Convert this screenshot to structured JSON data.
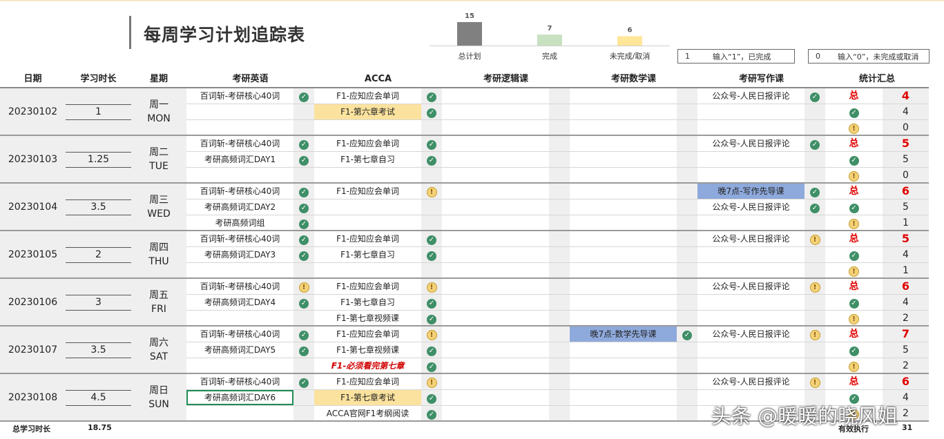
{
  "title": "每周学习计划追踪表",
  "summary_chart": {
    "bars": [
      {
        "label": "总计划",
        "value": 15,
        "color": "#808080"
      },
      {
        "label": "完成",
        "value": 7,
        "color": "#c8e1c0"
      },
      {
        "label": "未完成/取消",
        "value": 6,
        "color": "#ffe699"
      }
    ]
  },
  "legend": [
    {
      "num": "1",
      "text": "输入“1”，已完成"
    },
    {
      "num": "0",
      "text": "输入“0”，未完成或取消"
    }
  ],
  "headers": [
    "日期",
    "学习时长",
    "星期",
    "考研英语",
    "ACCA",
    "考研逻辑课",
    "考研数学课",
    "考研写作课",
    "统计汇总"
  ],
  "days": [
    {
      "date": "20230102",
      "hours": "1",
      "weekday_cn": "周一",
      "weekday_en": "MON",
      "english": [
        [
          "百词斩-考研核心40词",
          "ok"
        ],
        [
          "",
          ""
        ],
        [
          "",
          ""
        ]
      ],
      "acca": [
        [
          "F1-应知应会单词",
          "ok"
        ],
        [
          "F1-第六章考试",
          "ok",
          "#fbe29e"
        ],
        [
          "",
          ""
        ]
      ],
      "logic": [
        [
          "",
          ""
        ],
        [
          "",
          ""
        ],
        [
          "",
          ""
        ]
      ],
      "math": [
        [
          "",
          ""
        ],
        [
          "",
          ""
        ],
        [
          "",
          ""
        ]
      ],
      "writing": [
        [
          "公众号-人民日报评论",
          "ok"
        ],
        [
          "",
          ""
        ],
        [
          "",
          ""
        ]
      ],
      "stats": {
        "total_label": "总",
        "total": "4",
        "done": "4",
        "undone": "0"
      }
    },
    {
      "date": "20230103",
      "hours": "1.25",
      "weekday_cn": "周二",
      "weekday_en": "TUE",
      "english": [
        [
          "百词斩-考研核心40词",
          "ok"
        ],
        [
          "考研高频词汇DAY1",
          "ok"
        ],
        [
          "",
          ""
        ]
      ],
      "acca": [
        [
          "F1-应知应会单词",
          "ok"
        ],
        [
          "F1-第七章自习",
          "ok"
        ],
        [
          "",
          ""
        ]
      ],
      "logic": [
        [
          "",
          ""
        ],
        [
          "",
          ""
        ],
        [
          "",
          ""
        ]
      ],
      "math": [
        [
          "",
          ""
        ],
        [
          "",
          ""
        ],
        [
          "",
          ""
        ]
      ],
      "writing": [
        [
          "公众号-人民日报评论",
          "ok"
        ],
        [
          "",
          ""
        ],
        [
          "",
          ""
        ]
      ],
      "stats": {
        "total_label": "总",
        "total": "5",
        "done": "5",
        "undone": "0"
      }
    },
    {
      "date": "20230104",
      "hours": "3.5",
      "weekday_cn": "周三",
      "weekday_en": "WED",
      "english": [
        [
          "百词斩-考研核心40词",
          "ok"
        ],
        [
          "考研高频词汇DAY2",
          "ok"
        ],
        [
          "考研高频词组",
          "ok"
        ]
      ],
      "acca": [
        [
          "F1-应知应会单词",
          "wait"
        ],
        [
          "",
          ""
        ],
        [
          "",
          ""
        ]
      ],
      "logic": [
        [
          "",
          ""
        ],
        [
          "",
          ""
        ],
        [
          "",
          ""
        ]
      ],
      "math": [
        [
          "",
          ""
        ],
        [
          "",
          ""
        ],
        [
          "",
          ""
        ]
      ],
      "writing": [
        [
          "晚7点-写作先导课",
          "ok",
          "#8ea9db"
        ],
        [
          "公众号-人民日报评论",
          "ok"
        ],
        [
          "",
          ""
        ]
      ],
      "stats": {
        "total_label": "总",
        "total": "6",
        "done": "5",
        "undone": "1"
      }
    },
    {
      "date": "20230105",
      "hours": "2",
      "weekday_cn": "周四",
      "weekday_en": "THU",
      "english": [
        [
          "百词斩-考研核心40词",
          "ok"
        ],
        [
          "考研高频词汇DAY3",
          "ok"
        ],
        [
          "",
          ""
        ]
      ],
      "acca": [
        [
          "F1-应知应会单词",
          "ok"
        ],
        [
          "F1-第七章自习",
          "ok"
        ],
        [
          "",
          ""
        ]
      ],
      "logic": [
        [
          "",
          ""
        ],
        [
          "",
          ""
        ],
        [
          "",
          ""
        ]
      ],
      "math": [
        [
          "",
          ""
        ],
        [
          "",
          ""
        ],
        [
          "",
          ""
        ]
      ],
      "writing": [
        [
          "公众号-人民日报评论",
          "wait"
        ],
        [
          "",
          ""
        ],
        [
          "",
          ""
        ]
      ],
      "stats": {
        "total_label": "总",
        "total": "5",
        "done": "4",
        "undone": "1"
      }
    },
    {
      "date": "20230106",
      "hours": "3",
      "weekday_cn": "周五",
      "weekday_en": "FRI",
      "english": [
        [
          "百词斩-考研核心40词",
          "wait"
        ],
        [
          "考研高频词汇DAY4",
          "ok"
        ],
        [
          "",
          ""
        ]
      ],
      "acca": [
        [
          "F1-应知应会单词",
          "wait"
        ],
        [
          "F1-第七章自习",
          "ok"
        ],
        [
          "F1-第七章视频课",
          "ok"
        ]
      ],
      "logic": [
        [
          "",
          ""
        ],
        [
          "",
          ""
        ],
        [
          "",
          ""
        ]
      ],
      "math": [
        [
          "",
          ""
        ],
        [
          "",
          ""
        ],
        [
          "",
          ""
        ]
      ],
      "writing": [
        [
          "公众号-人民日报评论",
          "wait"
        ],
        [
          "",
          ""
        ],
        [
          "",
          ""
        ]
      ],
      "stats": {
        "total_label": "总",
        "total": "6",
        "done": "4",
        "undone": "2"
      }
    },
    {
      "date": "20230107",
      "hours": "3.5",
      "weekday_cn": "周六",
      "weekday_en": "SAT",
      "english": [
        [
          "百词斩-考研核心40词",
          "ok"
        ],
        [
          "考研高频词汇DAY5",
          "ok"
        ],
        [
          "",
          ""
        ]
      ],
      "acca": [
        [
          "F1-应知应会单词",
          "wait"
        ],
        [
          "F1-第七章视频课",
          "ok"
        ],
        [
          "F1-必须看完第七章",
          "ok",
          "",
          "red"
        ]
      ],
      "logic": [
        [
          "",
          ""
        ],
        [
          "",
          ""
        ],
        [
          "",
          ""
        ]
      ],
      "math": [
        [
          "晚7点-数学先导课",
          "ok",
          "#8ea9db"
        ],
        [
          "",
          ""
        ],
        [
          "",
          ""
        ]
      ],
      "writing": [
        [
          "公众号-人民日报评论",
          "wait"
        ],
        [
          "",
          ""
        ],
        [
          "",
          ""
        ]
      ],
      "stats": {
        "total_label": "总",
        "total": "7",
        "done": "5",
        "undone": "2"
      }
    },
    {
      "date": "20230108",
      "hours": "4.5",
      "weekday_cn": "周日",
      "weekday_en": "SUN",
      "english": [
        [
          "百词斩-考研核心40词",
          "ok"
        ],
        [
          "考研高频词汇DAY6",
          "",
          "",
          "sel"
        ],
        [
          "",
          ""
        ]
      ],
      "acca": [
        [
          "F1-应知应会单词",
          "wait"
        ],
        [
          "F1-第七章考试",
          "ok",
          "#fbe29e"
        ],
        [
          "ACCA官网F1考纲阅读",
          "ok"
        ]
      ],
      "logic": [
        [
          "",
          ""
        ],
        [
          "",
          ""
        ],
        [
          "",
          ""
        ]
      ],
      "math": [
        [
          "",
          ""
        ],
        [
          "",
          ""
        ],
        [
          "",
          ""
        ]
      ],
      "writing": [
        [
          "公众号-人民日报评论",
          "wait"
        ],
        [
          "",
          ""
        ],
        [
          "",
          ""
        ]
      ],
      "stats": {
        "total_label": "总",
        "total": "6",
        "done": "4",
        "undone": "2"
      }
    }
  ],
  "footer": {
    "total_hours_label": "总学习时长",
    "total_hours": "18.75",
    "effective_label": "有效执行",
    "effective": "31"
  },
  "watermark": "头条 @暖暖的晓风姐",
  "icons": {
    "done": "check-circle-icon",
    "undone": "exclamation-circle-icon"
  }
}
